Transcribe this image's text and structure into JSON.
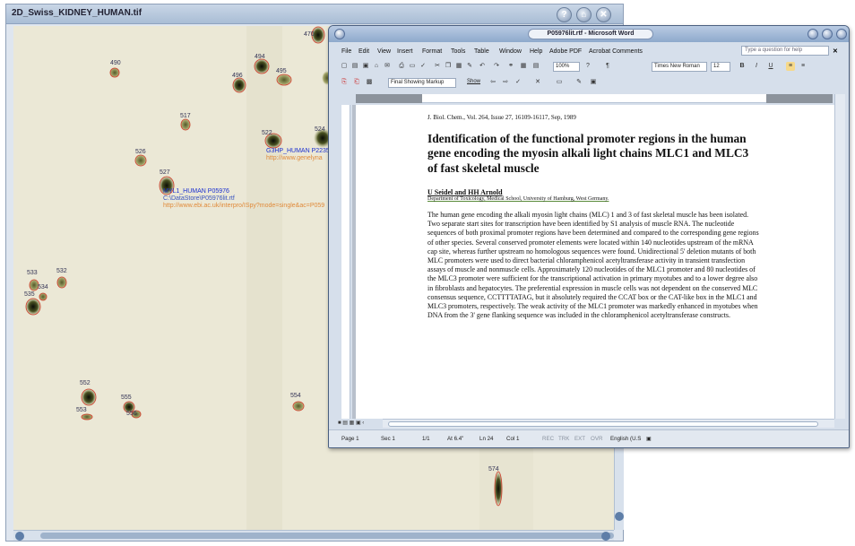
{
  "gel_window": {
    "title": "2D_Swiss_KIDNEY_HUMAN.tif",
    "controls": [
      "?",
      "⌂",
      "✕"
    ],
    "spots": [
      "470",
      "490",
      "494",
      "495",
      "496",
      "517",
      "522",
      "526",
      "527",
      "524",
      "532",
      "533",
      "534",
      "535",
      "552",
      "553",
      "555",
      "556",
      "554",
      "574"
    ],
    "annotation_myl1": {
      "name": "MYL1_HUMAN P05976",
      "file": "C:\\DataStore\\P05976lit.rtf",
      "url": "http://www.ebi.ac.uk/interpro/ISpy?mode=single&ac=P059"
    },
    "annotation_g3p": {
      "name": "G3HP_HUMAN P2235",
      "url": "http://www.genelyna"
    }
  },
  "word_window": {
    "title": "P05976lit.rtf - Microsoft Word",
    "menu": [
      "File",
      "Edit",
      "View",
      "Insert",
      "Format",
      "Tools",
      "Table",
      "Window",
      "Help",
      "Adobe PDF",
      "Acrobat Comments"
    ],
    "help_placeholder": "Type a question for help",
    "toolbar": {
      "zoom": "100%",
      "font": "Times New Roman",
      "size": "12",
      "bold": "B",
      "italic": "I",
      "underline": "U",
      "markup": "Final Showing Markup",
      "show": "Show"
    },
    "document": {
      "reference": "J. Biol. Chem., Vol. 264, Issue 27, 16109-16117, Sep, 1989",
      "title": "Identification of the functional promoter regions in the human gene encoding the myosin alkali light chains MLC1 and MLC3 of fast skeletal muscle",
      "authors": "U Seidel and HH Arnold",
      "affiliation": "Department of Toxicology, Medical School, University of Hamburg, West Germany.",
      "abstract": "The human gene encoding the alkali myosin light chains (MLC) 1 and 3 of fast skeletal muscle has been isolated. Two separate start sites for transcription have been identified by S1 analysis of muscle RNA. The nucleotide sequences of both proximal promoter regions have been determined and compared to the corresponding gene regions of other species. Several conserved promoter elements were located within 140 nucleotides upstream of the mRNA cap site, whereas further upstream no homologous sequences were found. Unidirectional 5' deletion mutants of both MLC promoters were used to direct bacterial chloramphenicol acetyltransferase activity in transient transfection assays of muscle and nonmuscle cells. Approximately 120 nucleotides of the MLC1 promoter and 80 nucleotides of the MLC3 promoter were sufficient for the transcriptional activation in primary myotubes and to a lower degree also in fibroblasts and hepatocytes. The preferential expression in muscle cells was not dependent on the conserved MLC consensus sequence, CCTTTTATAG, but it absolutely required the CCAT box or the CAT-like box in the MLC1 and MLC3 promoters, respectively. The weak activity of the MLC1 promoter was markedly enhanced in myotubes when DNA from the 3' gene flanking sequence was included in the chloramphenicol acetyltransferase constructs."
    },
    "status": {
      "page": "Page 1",
      "sec": "Sec 1",
      "pages": "1/1",
      "at": "At 6.4\"",
      "ln": "Ln 24",
      "col": "Col 1",
      "rec": "REC",
      "trk": "TRK",
      "ext": "EXT",
      "ovr": "OVR",
      "lang": "English (U.S"
    }
  }
}
